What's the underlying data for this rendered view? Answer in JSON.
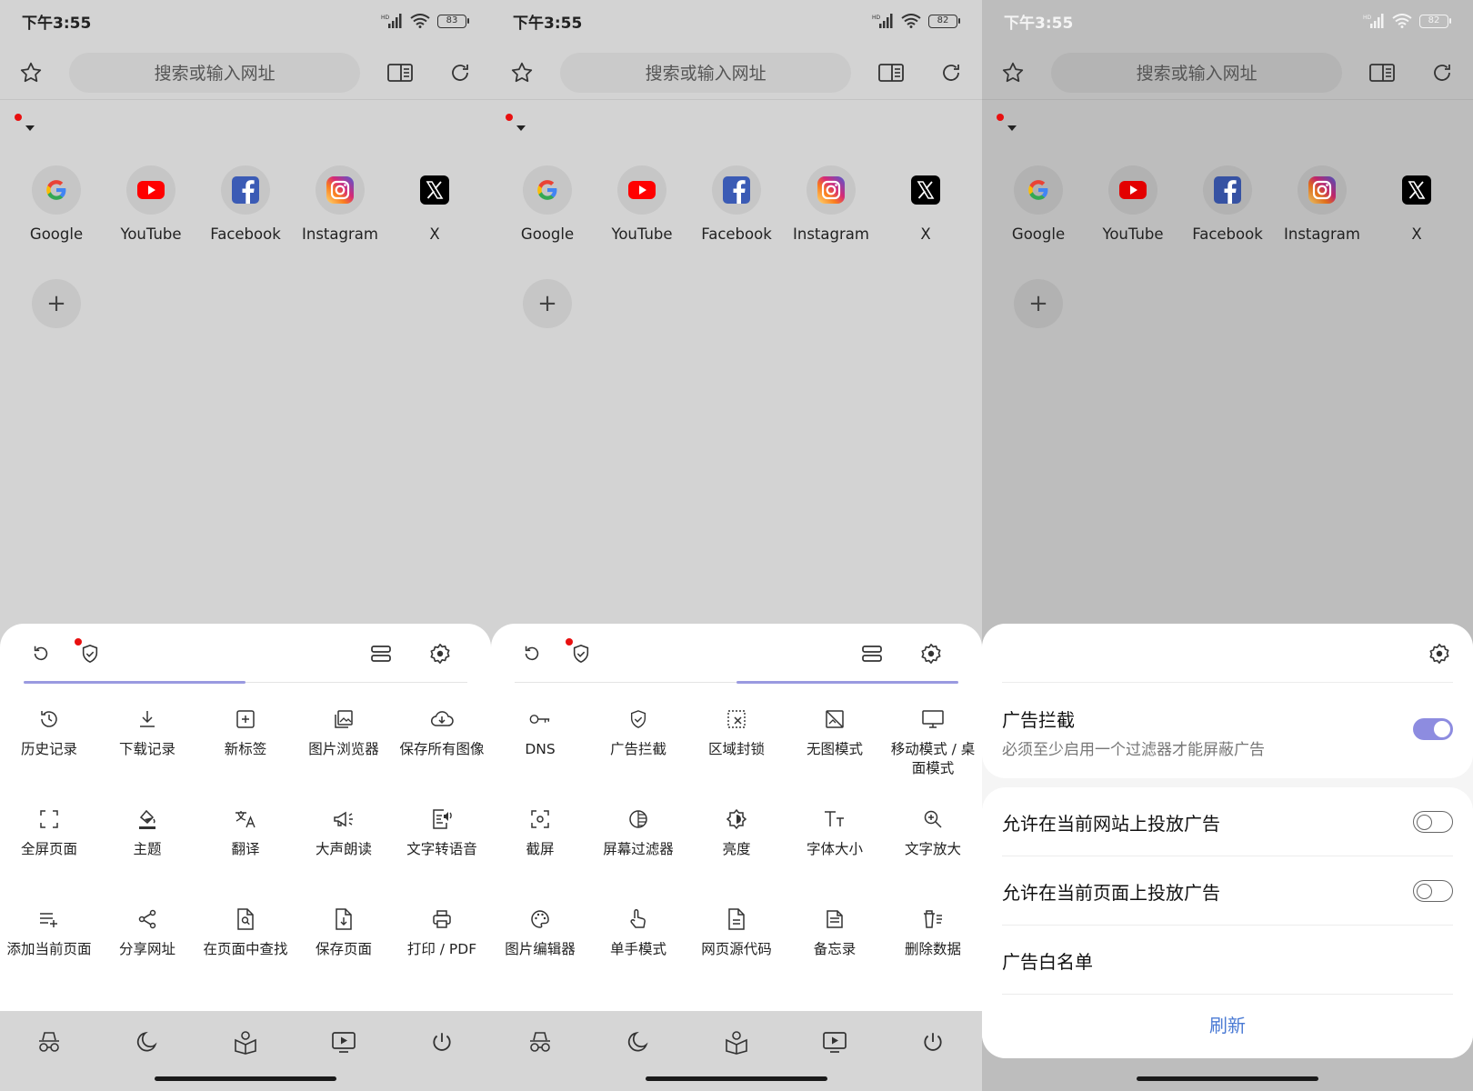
{
  "status": {
    "time": "下午3:55",
    "battery_screens": [
      "83",
      "82",
      "82"
    ]
  },
  "toolbar": {
    "search_placeholder": "搜索或输入网址"
  },
  "shortcuts": [
    {
      "label": "Google",
      "icon": "google-icon"
    },
    {
      "label": "YouTube",
      "icon": "youtube-icon"
    },
    {
      "label": "Facebook",
      "icon": "facebook-icon"
    },
    {
      "label": "Instagram",
      "icon": "instagram-icon"
    },
    {
      "label": "X",
      "icon": "x-icon"
    }
  ],
  "add_label": "+",
  "menu1": [
    {
      "label": "历史记录",
      "icon": "history-icon"
    },
    {
      "label": "下载记录",
      "icon": "download-icon"
    },
    {
      "label": "新标签",
      "icon": "new-tab-icon"
    },
    {
      "label": "图片浏览器",
      "icon": "image-browser-icon"
    },
    {
      "label": "保存所有图像",
      "icon": "cloud-save-icon"
    },
    {
      "label": "全屏页面",
      "icon": "fullscreen-icon"
    },
    {
      "label": "主题",
      "icon": "theme-icon"
    },
    {
      "label": "翻译",
      "icon": "translate-icon"
    },
    {
      "label": "大声朗读",
      "icon": "read-aloud-icon"
    },
    {
      "label": "文字转语音",
      "icon": "tts-icon"
    },
    {
      "label": "添加当前页面",
      "icon": "add-page-icon"
    },
    {
      "label": "分享网址",
      "icon": "share-icon"
    },
    {
      "label": "在页面中查找",
      "icon": "find-in-page-icon"
    },
    {
      "label": "保存页面",
      "icon": "save-page-icon"
    },
    {
      "label": "打印 / PDF",
      "icon": "print-icon"
    }
  ],
  "menu2": [
    {
      "label": "DNS",
      "icon": "dns-key-icon"
    },
    {
      "label": "广告拦截",
      "icon": "ad-block-shield-icon"
    },
    {
      "label": "区域封锁",
      "icon": "area-block-icon"
    },
    {
      "label": "无图模式",
      "icon": "no-image-icon"
    },
    {
      "label": "移动模式 / 桌面模式",
      "icon": "desktop-mode-icon"
    },
    {
      "label": "截屏",
      "icon": "screenshot-icon"
    },
    {
      "label": "屏幕过滤器",
      "icon": "screen-filter-icon"
    },
    {
      "label": "亮度",
      "icon": "brightness-icon"
    },
    {
      "label": "字体大小",
      "icon": "font-size-icon"
    },
    {
      "label": "文字放大",
      "icon": "zoom-text-icon"
    },
    {
      "label": "图片编辑器",
      "icon": "palette-icon"
    },
    {
      "label": "单手模式",
      "icon": "one-hand-icon"
    },
    {
      "label": "网页源代码",
      "icon": "source-code-icon"
    },
    {
      "label": "备忘录",
      "icon": "memo-icon"
    },
    {
      "label": "删除数据",
      "icon": "delete-data-icon"
    }
  ],
  "adblock": {
    "title": "广告拦截",
    "subtitle": "必须至少启用一个过滤器才能屏蔽广告",
    "enabled": true,
    "allow_site": "允许在当前网站上投放广告",
    "allow_site_enabled": false,
    "allow_page": "允许在当前页面上投放广告",
    "allow_page_enabled": false,
    "whitelist": "广告白名单",
    "refresh": "刷新"
  },
  "colors": {
    "accent": "#8d8ce0",
    "link": "#4a7ad4",
    "badge": "#e81010"
  }
}
